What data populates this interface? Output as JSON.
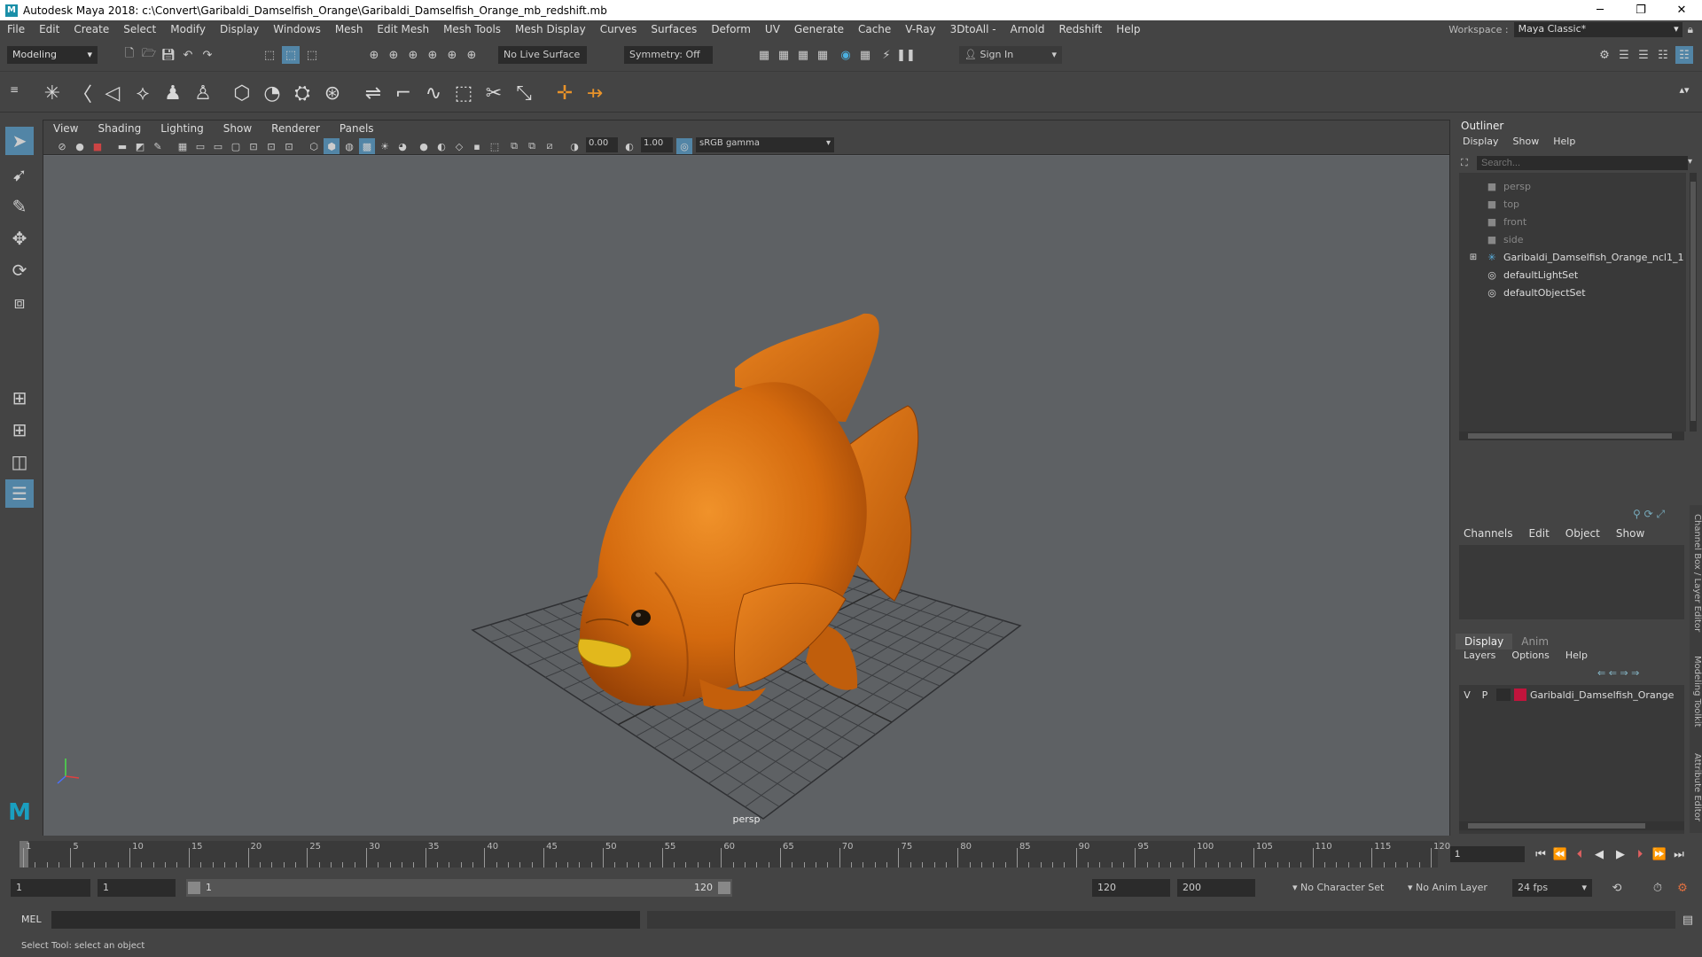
{
  "window": {
    "app_title": "Autodesk Maya 2018: c:\\Convert\\Garibaldi_Damselfish_Orange\\Garibaldi_Damselfish_Orange_mb_redshift.mb",
    "minimize": "─",
    "maximize": "❐",
    "close": "✕"
  },
  "menubar": [
    "File",
    "Edit",
    "Create",
    "Select",
    "Modify",
    "Display",
    "Windows",
    "Mesh",
    "Edit Mesh",
    "Mesh Tools",
    "Mesh Display",
    "Curves",
    "Surfaces",
    "Deform",
    "UV",
    "Generate",
    "Cache",
    "V-Ray",
    "3DtoAll -",
    "Arnold",
    "Redshift",
    "Help"
  ],
  "workspace": {
    "label": "Workspace :",
    "value": "Maya Classic*"
  },
  "statusline": {
    "mode": "Modeling",
    "live_surface": "No Live Surface",
    "symmetry": "Symmetry: Off",
    "sign_in": "Sign In"
  },
  "viewport": {
    "menus": [
      "View",
      "Shading",
      "Lighting",
      "Show",
      "Renderer",
      "Panels"
    ],
    "exposure": "0.00",
    "gamma": "1.00",
    "colorspace": "sRGB gamma",
    "camera_label": "persp"
  },
  "outliner": {
    "title": "Outliner",
    "menus": [
      "Display",
      "Show",
      "Help"
    ],
    "search_placeholder": "Search...",
    "items": [
      {
        "label": "persp",
        "icon": "camera-icon",
        "dim": true
      },
      {
        "label": "top",
        "icon": "camera-icon",
        "dim": true
      },
      {
        "label": "front",
        "icon": "camera-icon",
        "dim": true
      },
      {
        "label": "side",
        "icon": "camera-icon",
        "dim": true
      },
      {
        "label": "Garibaldi_Damselfish_Orange_ncl1_1",
        "icon": "transform-icon",
        "dim": false,
        "expandable": true
      },
      {
        "label": "defaultLightSet",
        "icon": "set-icon",
        "dim": false
      },
      {
        "label": "defaultObjectSet",
        "icon": "set-icon",
        "dim": false
      }
    ]
  },
  "channelbox": {
    "menus": [
      "Channels",
      "Edit",
      "Object",
      "Show"
    ]
  },
  "layer_editor": {
    "tabs": [
      "Display",
      "Anim"
    ],
    "menus": [
      "Layers",
      "Options",
      "Help"
    ],
    "layer": {
      "v": "V",
      "p": "P",
      "name": "Garibaldi_Damselfish_Orange",
      "color": "#c0143c"
    }
  },
  "side_tabs": [
    "Channel Box / Layer Editor",
    "Modeling Toolkit",
    "Attribute Editor"
  ],
  "timeline": {
    "ticks": [
      1,
      5,
      10,
      15,
      20,
      25,
      30,
      35,
      40,
      45,
      50,
      55,
      60,
      65,
      70,
      75,
      80,
      85,
      90,
      95,
      100,
      105,
      110,
      115,
      120
    ],
    "current_frame": "1"
  },
  "range": {
    "start": "1",
    "playback_start": "1",
    "slider_start": "1",
    "slider_end": "120",
    "playback_end": "120",
    "end": "200",
    "character_set": "No Character Set",
    "anim_layer": "No Anim Layer",
    "fps": "24 fps"
  },
  "command": {
    "label": "MEL"
  },
  "help_line": "Select Tool: select an object",
  "colors": {
    "fish_orange": "#e07a12",
    "fish_lips": "#e8c020",
    "maya_teal": "#1a8fa8"
  }
}
